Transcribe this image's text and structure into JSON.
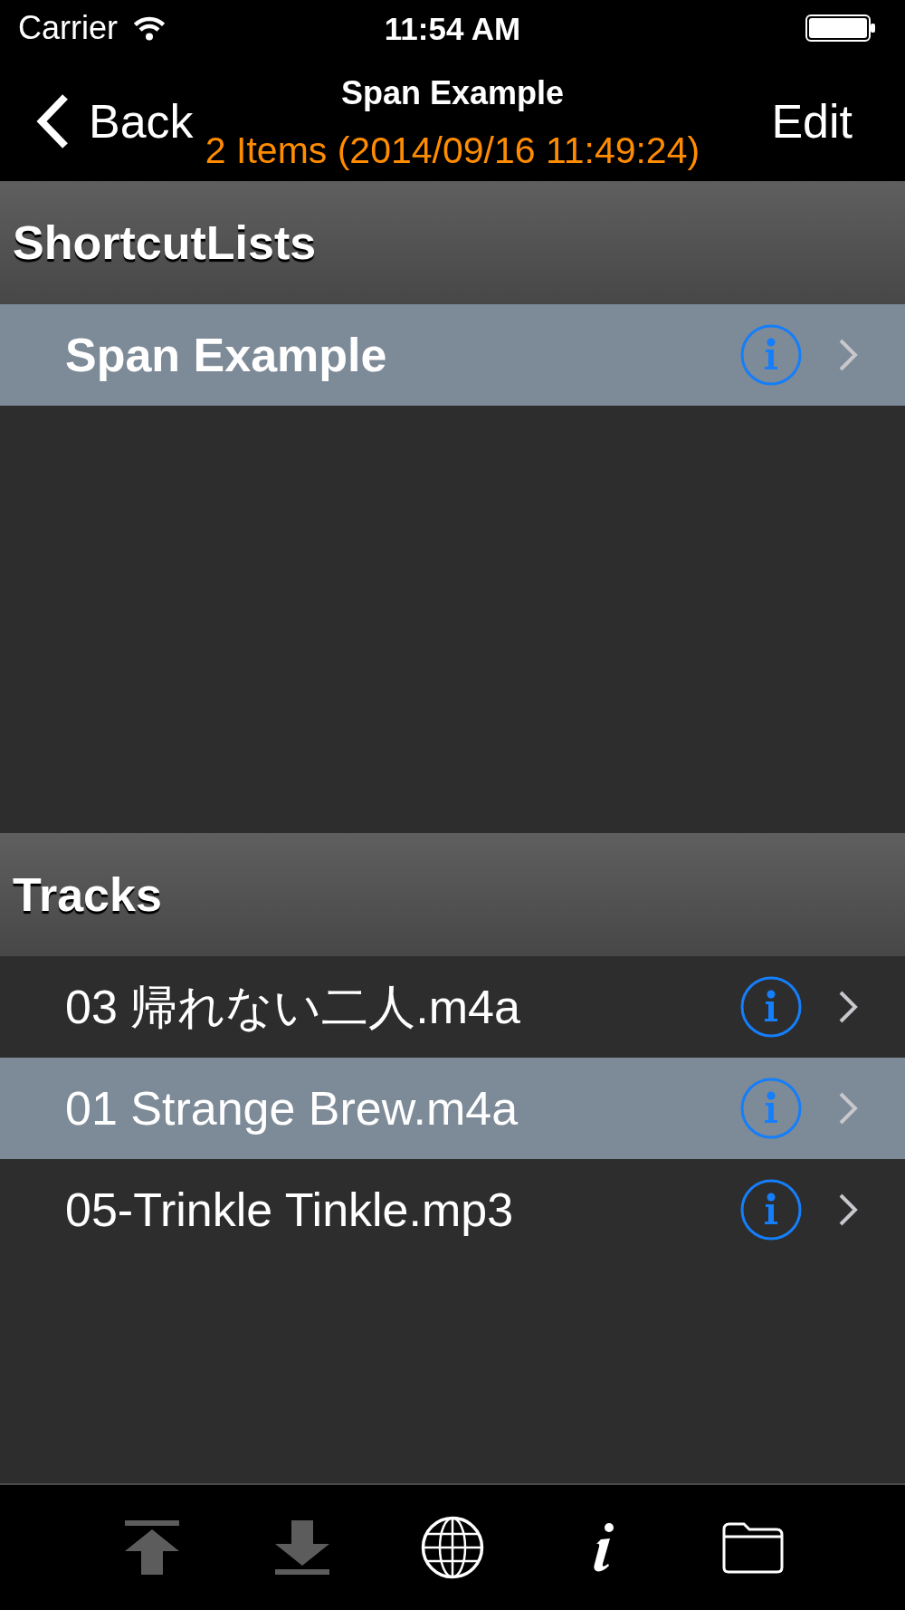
{
  "status_bar": {
    "carrier": "Carrier",
    "time": "11:54 AM"
  },
  "nav_bar": {
    "back": "Back",
    "title": "Span Example",
    "subtitle": "2 Items (2014/09/16 11:49:24)",
    "edit": "Edit"
  },
  "sections": [
    {
      "title": "ShortcutLists",
      "rows": [
        {
          "kind": "shortcut",
          "label": "Span Example",
          "selected": true
        }
      ]
    },
    {
      "title": "Tracks",
      "rows": [
        {
          "kind": "track",
          "label": "03 帰れない二人.m4a",
          "selected": false
        },
        {
          "kind": "track",
          "label": "01 Strange Brew.m4a",
          "selected": true
        },
        {
          "kind": "track",
          "label": "05-Trinkle Tinkle.mp3",
          "selected": false
        }
      ]
    }
  ],
  "toolbar": [
    {
      "kind": "upload",
      "disabled": true
    },
    {
      "kind": "download",
      "disabled": true
    },
    {
      "kind": "globe",
      "disabled": false
    },
    {
      "kind": "info",
      "disabled": false
    },
    {
      "kind": "folder",
      "disabled": false
    }
  ]
}
